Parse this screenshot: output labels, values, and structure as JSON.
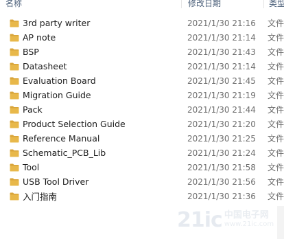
{
  "columns": {
    "name": "名称",
    "date": "修改日期",
    "type": "类型"
  },
  "folders": [
    {
      "name": "3rd party writer",
      "modified": "2021/1/30 21:16",
      "type": "文件"
    },
    {
      "name": "AP note",
      "modified": "2021/1/30 21:14",
      "type": "文件"
    },
    {
      "name": "BSP",
      "modified": "2021/1/30 21:43",
      "type": "文件"
    },
    {
      "name": "Datasheet",
      "modified": "2021/1/30 21:14",
      "type": "文件"
    },
    {
      "name": "Evaluation Board",
      "modified": "2021/1/30 21:45",
      "type": "文件"
    },
    {
      "name": "Migration Guide",
      "modified": "2021/1/30 21:19",
      "type": "文件"
    },
    {
      "name": "Pack",
      "modified": "2021/1/30 21:44",
      "type": "文件"
    },
    {
      "name": "Product Selection Guide",
      "modified": "2021/1/30 21:20",
      "type": "文件"
    },
    {
      "name": "Reference Manual",
      "modified": "2021/1/30 21:25",
      "type": "文件"
    },
    {
      "name": "Schematic_PCB_Lib",
      "modified": "2021/1/30 21:24",
      "type": "文件"
    },
    {
      "name": "Tool",
      "modified": "2021/1/30 21:58",
      "type": "文件"
    },
    {
      "name": "USB Tool Driver",
      "modified": "2021/1/30 21:56",
      "type": "文件"
    },
    {
      "name": "入门指南",
      "modified": "2021/1/30 21:36",
      "type": "文件"
    }
  ],
  "icons": {
    "folder": "folder-icon"
  },
  "colors": {
    "folder_body": "#e8b84a",
    "folder_tab": "#d9a53a",
    "header_text": "#4c607a"
  },
  "watermark": {
    "brand": "21ic",
    "cn": "中国电子网",
    "domain": "www.21ic.com"
  }
}
